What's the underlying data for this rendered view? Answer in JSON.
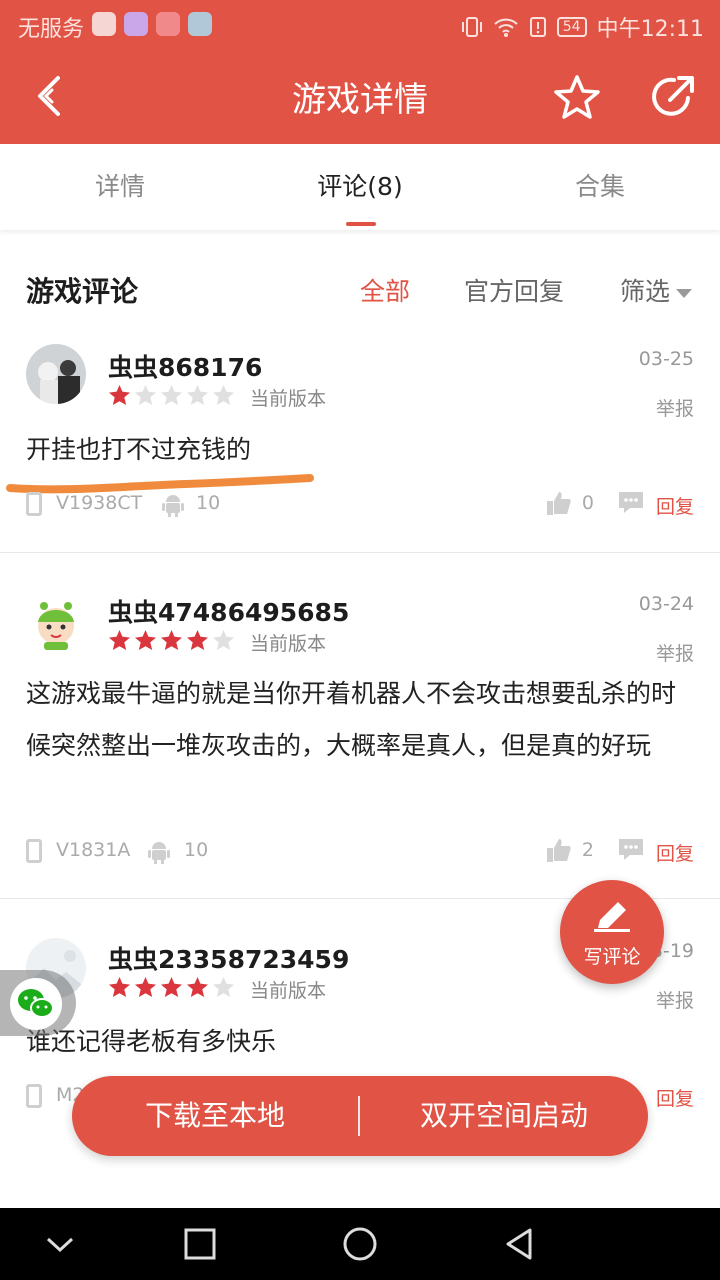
{
  "status_bar": {
    "carrier": "无服务",
    "battery": "54",
    "time": "中午12:11"
  },
  "header": {
    "title": "游戏详情"
  },
  "tabs": [
    {
      "label": "详情"
    },
    {
      "label": "评论(8)"
    },
    {
      "label": "合集"
    }
  ],
  "comments_section": {
    "title": "游戏评论",
    "filters": {
      "all": "全部",
      "official": "官方回复",
      "screen": "筛选"
    }
  },
  "comments": [
    {
      "username": "虫虫868176",
      "rating": 1,
      "version_tag": "当前版本",
      "date": "03-25",
      "report": "举报",
      "text": "开挂也打不过充钱的",
      "device_model": "V1938CT",
      "android_version": "10",
      "likes": "0",
      "reply": "回复"
    },
    {
      "username": "虫虫47486495685",
      "rating": 4,
      "version_tag": "当前版本",
      "date": "03-24",
      "report": "举报",
      "text": "这游戏最牛逼的就是当你开着机器人不会攻击想要乱杀的时候突然整出一堆灰攻击的，大概率是真人，但是真的好玩",
      "device_model": "V1831A",
      "android_version": "10",
      "likes": "2",
      "reply": "回复"
    },
    {
      "username": "虫虫23358723459",
      "rating": 4,
      "version_tag": "当前版本",
      "date": "03-19",
      "report": "举报",
      "text": "谁还记得老板有多快乐",
      "device_model": "M2",
      "android_version": "",
      "likes": "",
      "reply": "回复"
    }
  ],
  "fab": {
    "label": "写评论"
  },
  "bottom_actions": {
    "download": "下载至本地",
    "dual_launch": "双开空间启动"
  },
  "colors": {
    "accent": "#e05345",
    "star_on": "#d9363e",
    "star_off": "#e0e0e0"
  }
}
